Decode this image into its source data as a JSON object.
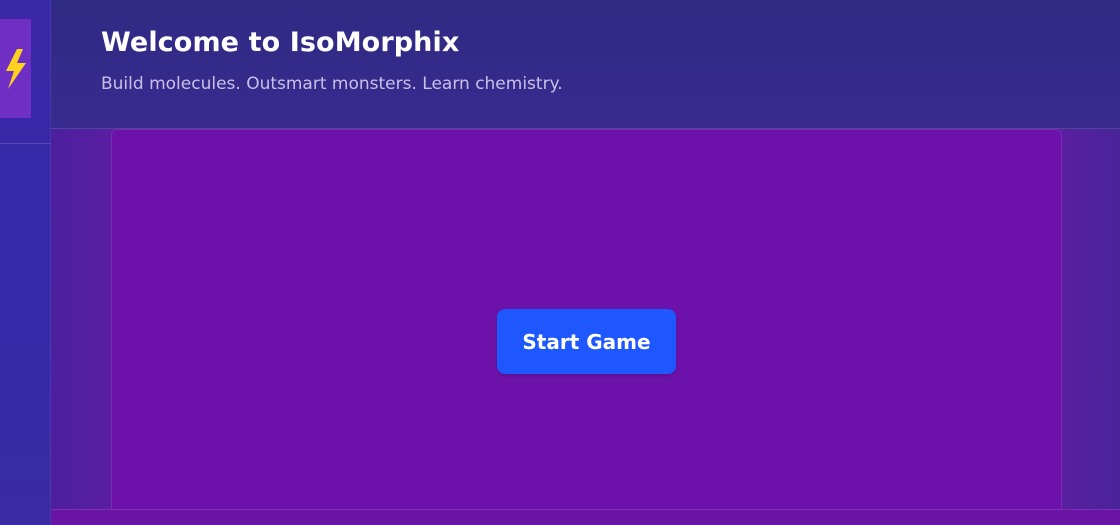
{
  "app": {
    "title": "Welcome to IsoMorphix",
    "subtitle": "Build molecules. Outsmart monsters. Learn chemistry."
  },
  "sidebar": {
    "logo_icon": "lightning-bolt-icon"
  },
  "game": {
    "start_label": "Start Game"
  },
  "colors": {
    "accent_button": "#1f57ff",
    "game_canvas": "#6c12ab",
    "header_background": "#2f2a83",
    "sidebar_background": "#3529a8",
    "logo_tile": "#6f2ec4",
    "bolt": "#ffd21f"
  }
}
